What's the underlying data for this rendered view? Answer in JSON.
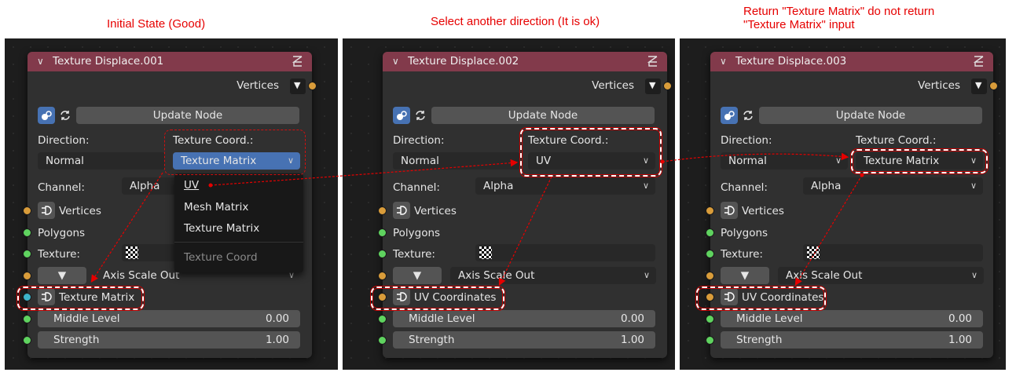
{
  "captions": [
    "Initial State (Good)",
    "Select another direction (It is ok)",
    "Return \"Texture Matrix\" do not return",
    "\"Texture Matrix\" input"
  ],
  "labels": {
    "vertices_out": "Vertices",
    "update_node": "Update Node",
    "direction": "Direction:",
    "texture_coord": "Texture Coord.:",
    "channel": "Channel:",
    "vertices_in": "Vertices",
    "polygons": "Polygons",
    "texture": "Texture:",
    "axis_scale_out": "Axis Scale Out",
    "middle_level": "Middle Level",
    "strength": "Strength"
  },
  "nodes": [
    {
      "title": "Texture Displace.001",
      "direction": "Normal",
      "texture_coord": "Texture Matrix",
      "channel": "Alpha",
      "output_socket": "Texture Matrix",
      "middle_level": "0.00",
      "strength": "1.00"
    },
    {
      "title": "Texture Displace.002",
      "direction": "Normal",
      "texture_coord": "UV",
      "channel": "Alpha",
      "output_socket": "UV Coordinates",
      "middle_level": "0.00",
      "strength": "1.00"
    },
    {
      "title": "Texture Displace.003",
      "direction": "Normal",
      "texture_coord": "Texture Matrix",
      "channel": "Alpha",
      "output_socket": "UV Coordinates",
      "middle_level": "0.00",
      "strength": "1.00"
    }
  ],
  "dropdown_menu": {
    "items": [
      "UV",
      "Mesh Matrix",
      "Texture Matrix"
    ],
    "header": "Texture Coord"
  },
  "colors": {
    "node_header": "#823a4b",
    "selected_field": "#4772b3",
    "annotation": "#e60000",
    "socket_vertices": "#d99c3a",
    "socket_polygons": "#5fd35f",
    "socket_matrix": "#3cb3c9"
  }
}
